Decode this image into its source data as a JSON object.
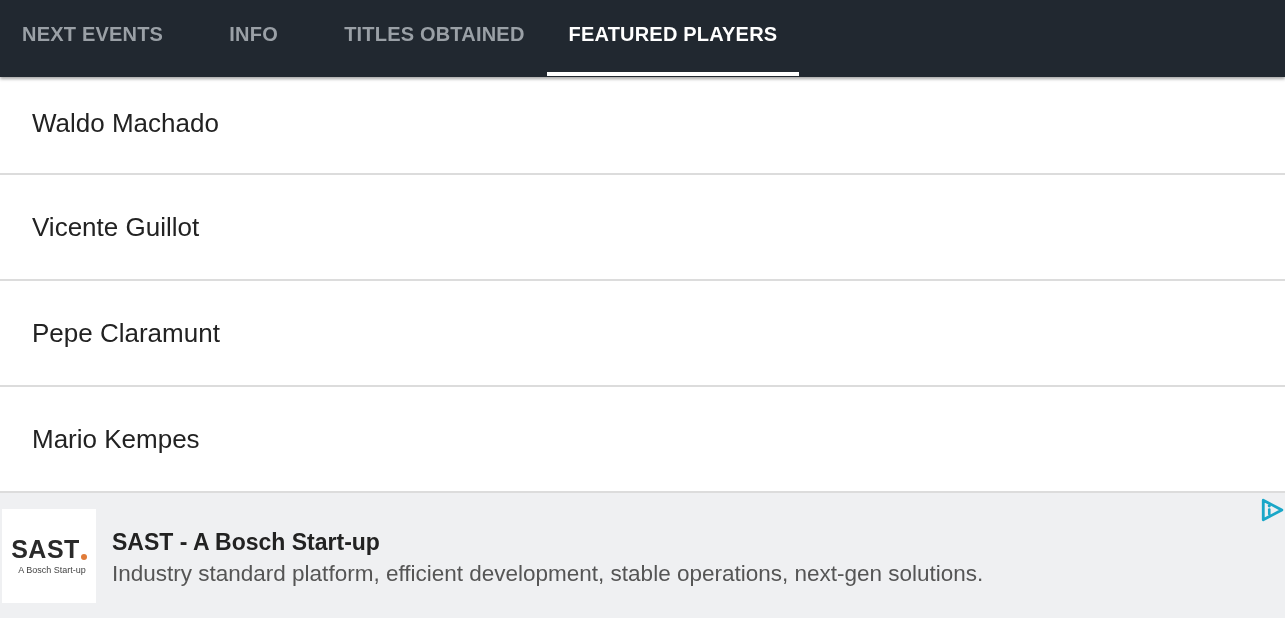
{
  "tabs": [
    {
      "label": "NEXT EVENTS",
      "selected": false
    },
    {
      "label": "INFO",
      "selected": false
    },
    {
      "label": "TITLES OBTAINED",
      "selected": false
    },
    {
      "label": "FEATURED PLAYERS",
      "selected": true
    }
  ],
  "players": [
    {
      "name": "Waldo Machado"
    },
    {
      "name": "Vicente Guillot"
    },
    {
      "name": "Pepe Claramunt"
    },
    {
      "name": "Mario Kempes"
    }
  ],
  "ad": {
    "logo": {
      "wordmark": "SAST",
      "tagline": "A Bosch Start-up"
    },
    "title": "SAST - A Bosch Start-up",
    "description": "Industry standard platform, efficient development, stable operations, next-gen solutions."
  }
}
